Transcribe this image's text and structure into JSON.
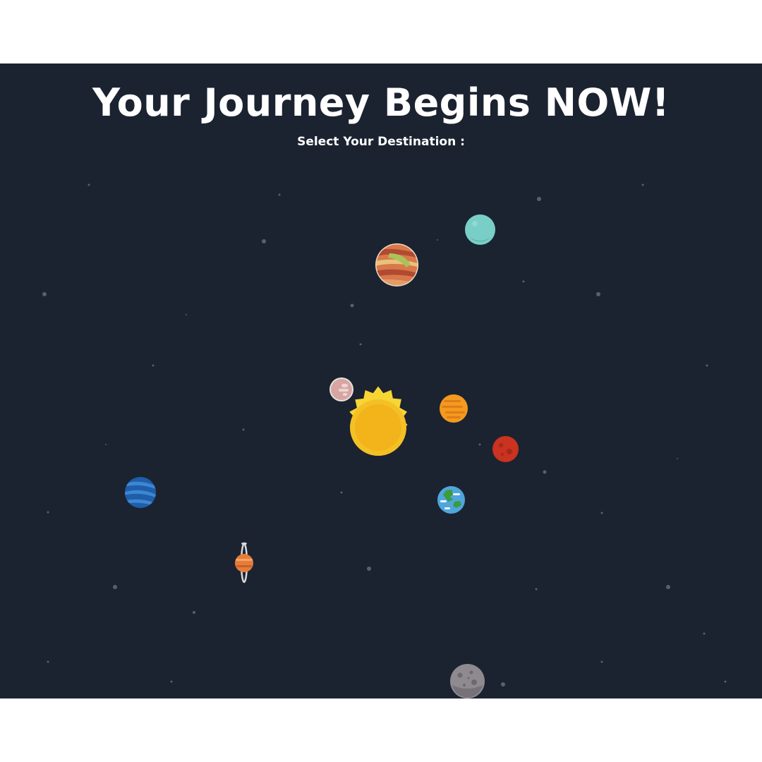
{
  "header": {
    "title": "Your Journey Begins NOW!",
    "subtitle": "Select Your Destination :"
  },
  "colors": {
    "space_background": "#1b2330",
    "page_background": "#ffffff",
    "text": "#ffffff",
    "sun": "#f2b31b",
    "sun_rays": "#f7d535"
  },
  "planets": [
    "sun",
    "mercury",
    "venus",
    "earth",
    "mars",
    "jupiter",
    "saturn",
    "uranus",
    "neptune",
    "moon"
  ]
}
